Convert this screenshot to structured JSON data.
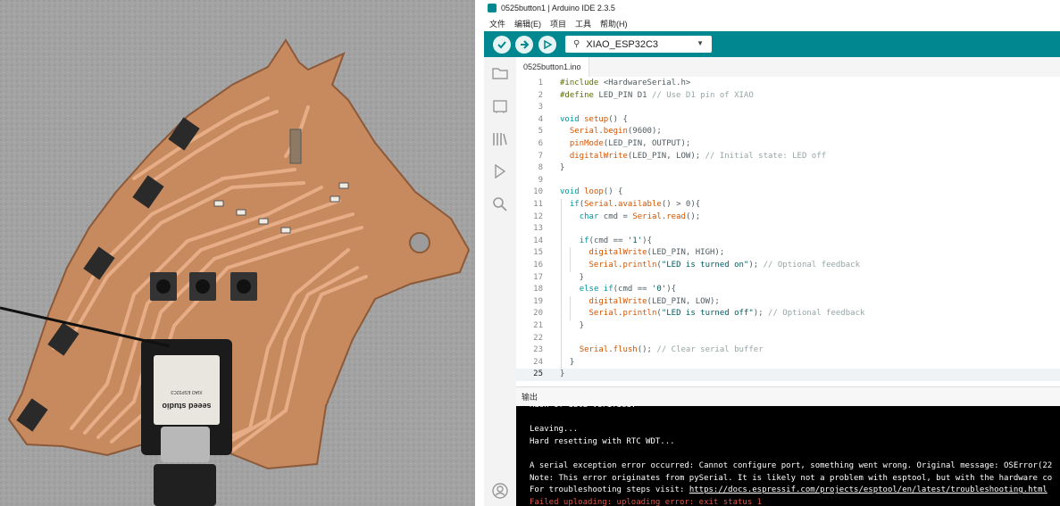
{
  "window": {
    "title": "0525button1 | Arduino IDE 2.3.5"
  },
  "menu": [
    "文件",
    "编辑(E)",
    "项目",
    "工具",
    "帮助(H)"
  ],
  "toolbar": {
    "board": "XIAO_ESP32C3",
    "verify_icon": "check-icon",
    "upload_icon": "arrow-right-icon",
    "debug_icon": "debug-icon"
  },
  "sidebar": [
    "folder-icon",
    "board-manager-icon",
    "library-icon",
    "debug-icon",
    "search-icon",
    "user-icon"
  ],
  "tab": {
    "label": "0525button1.ino"
  },
  "editor": {
    "current_line": 25,
    "lines": [
      "#include <HardwareSerial.h>",
      "#define LED_PIN D1 // Use D1 pin of XIAO",
      "",
      "void setup() {",
      "  Serial.begin(9600);",
      "  pinMode(LED_PIN, OUTPUT);",
      "  digitalWrite(LED_PIN, LOW); // Initial state: LED off",
      "}",
      "",
      "void loop() {",
      "  if(Serial.available() > 0){",
      "    char cmd = Serial.read();",
      "",
      "    if(cmd == '1'){",
      "      digitalWrite(LED_PIN, HIGH);",
      "      Serial.println(\"LED is turned on\"); // Optional feedback",
      "    }",
      "    else if(cmd == '0'){",
      "      digitalWrite(LED_PIN, LOW);",
      "      Serial.println(\"LED is turned off\"); // Optional feedback",
      "    }",
      "",
      "    Serial.flush(); // Clear serial buffer",
      "  }",
      "}"
    ]
  },
  "output": {
    "header": "输出",
    "lines": [
      {
        "text": "Hash of data verified.",
        "kind": "normal"
      },
      {
        "text": "",
        "kind": "normal"
      },
      {
        "text": "Leaving...",
        "kind": "normal"
      },
      {
        "text": "Hard resetting with RTC WDT...",
        "kind": "normal"
      },
      {
        "text": "",
        "kind": "normal"
      },
      {
        "text": "A serial exception error occurred: Cannot configure port, something went wrong. Original message: OSError(22",
        "kind": "normal"
      },
      {
        "text": "Note: This error originates from pySerial. It is likely not a problem with esptool, but with the hardware co",
        "kind": "normal"
      },
      {
        "text": "For troubleshooting steps visit: ",
        "kind": "normal",
        "link": "https://docs.espressif.com/projects/esptool/en/latest/troubleshooting.html"
      },
      {
        "text": "Failed uploading: uploading error: exit status 1",
        "kind": "error"
      }
    ]
  },
  "photo": {
    "module_brand": "seeed studio",
    "module_text": "XIAO ESP32C3",
    "colors": {
      "pcb": "#c98a5f",
      "copper": "#e2a57d",
      "background": "#9e9e9e"
    }
  },
  "colors": {
    "accent": "#00878f",
    "keyword": "#00979c",
    "string": "#005c5f",
    "comment": "#95a5a6",
    "error": "#e0574c"
  }
}
